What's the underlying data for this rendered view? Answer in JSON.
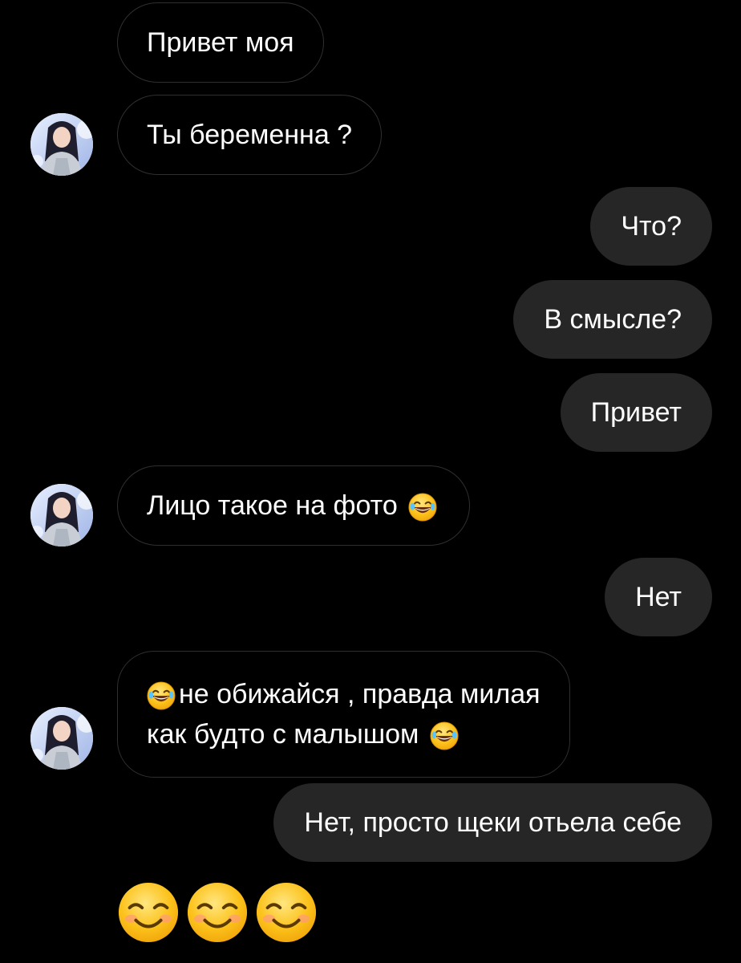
{
  "messages": [
    {
      "id": "m1",
      "direction": "incoming",
      "text": "Привет моя"
    },
    {
      "id": "m2",
      "direction": "incoming",
      "text": "Ты беременна ?"
    },
    {
      "id": "m3",
      "direction": "outgoing",
      "text": "Что?"
    },
    {
      "id": "m4",
      "direction": "outgoing",
      "text": "В смысле?"
    },
    {
      "id": "m5",
      "direction": "outgoing",
      "text": "Привет"
    },
    {
      "id": "m6",
      "direction": "incoming",
      "text": "Лицо такое на фото"
    },
    {
      "id": "m7",
      "direction": "outgoing",
      "text": "Нет"
    },
    {
      "id": "m8",
      "direction": "incoming",
      "line1": "не обижайся , правда милая",
      "line2": "как будто с малышом"
    },
    {
      "id": "m9",
      "direction": "outgoing",
      "text": "Нет, просто щеки отьела себе"
    }
  ],
  "emoji_message": [
    "smiling-face-emoji",
    "smiling-face-emoji",
    "smiling-face-emoji"
  ],
  "icons": {
    "laugh": "face-with-tears-of-joy-emoji",
    "avatar": "contact-avatar"
  },
  "colors": {
    "background": "#000000",
    "outgoing_bubble": "#262626",
    "incoming_border": "#2f2f2f",
    "text": "#ffffff",
    "emoji_yellow": "#fcc21b"
  }
}
